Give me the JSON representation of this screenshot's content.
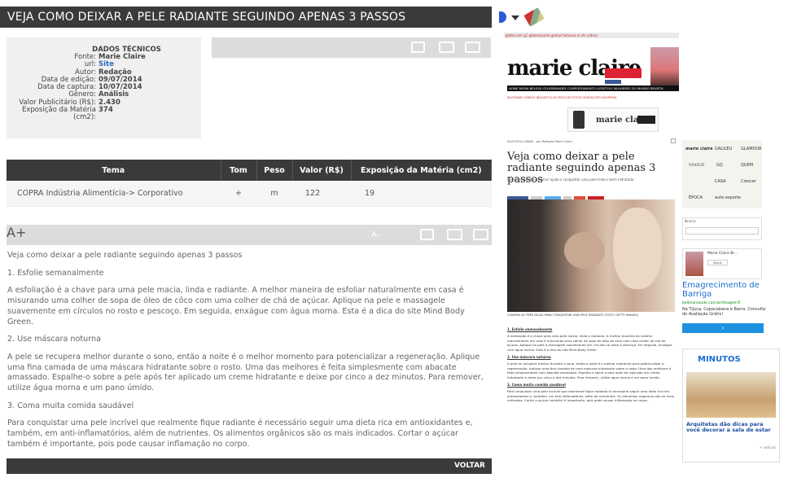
{
  "header": {
    "title": "VEJA COMO DEIXAR A PELE RADIANTE SEGUINDO APENAS 3 PASSOS"
  },
  "tech": {
    "heading": "DADOS TÉCNICOS",
    "rows": [
      {
        "k": "Fonte:",
        "v": "Marie Claire"
      },
      {
        "k": "url:",
        "v": "Site"
      },
      {
        "k": "Autor:",
        "v": "Redação"
      },
      {
        "k": "Data de edição:",
        "v": "09/07/2014"
      },
      {
        "k": "Data de captura:",
        "v": "10/07/2014"
      },
      {
        "k": "Gênero:",
        "v": "Análisis"
      },
      {
        "k": "Valor Publicitário (R$):",
        "v": "2.430"
      },
      {
        "k": "Exposição da Matéria (cm2):",
        "v": "374"
      }
    ]
  },
  "table": {
    "headers": [
      "Tema",
      "Tom",
      "Peso",
      "Valor (R$)",
      "Exposição da Matéria (cm2)"
    ],
    "row": [
      "COPRA Indústria Alimentícia-> Corporativo",
      "+",
      "m",
      "122",
      "19"
    ]
  },
  "toolbar2": {
    "a_minus": "A-",
    "a_plus": "A+"
  },
  "article": {
    "paragraphs": [
      "Veja como deixar a pele radiante seguindo apenas 3 passos",
      "1. Esfolie semanalmente",
      "A esfoliação é a chave para uma pele macia, linda e radiante. A melhor maneira de esfoliar naturalmente em casa é misurando uma colher de sopa de óleo de côco com uma colher de chá de açúcar. Aplique na pele e massagele suavemente em círculos no rosto e pescoço. Em seguida, enxágue com água morna. Esta é a dica do site Mind Body Green.",
      "2. Use máscara noturna",
      "A pele se recupera melhor durante o sono, então a noite é o melhor momento para potencializar a regeneração. Aplique uma fina camada de uma máscara hidratante sobre o rosto. Uma das melhores é feita simplesmente com abacate amassado. Espalhe-o sobre a pele após ter aplicado um creme hidratante e deixe por cinco a dez minutos. Para remover, utilize água morna e um pano úmido.",
      "3. Coma muita comida saudável",
      "Para conquistar uma pele incrível que realmente fique radiante é necessário seguir uma dieta rica em antioxidantes e, também, em anti-inflamatórios, além de nutrientes. Os alimentos orgânicos são os mais indicados. Cortar o açúcar também é importante, pois pode causar inflamação no corpo."
    ]
  },
  "footer": {
    "voltar": "VOLTAR"
  },
  "clipping": {
    "topbar": "globo.com  g1  globoesporte  gshow  famosos & etc  vídeos",
    "logo": "marie claire",
    "nav": "HOME  MODA  BELEZA  CELEBRIDADES  COMPORTAMENTO  LIFESTYLE  MULHERES DO MUNDO  REVISTA",
    "subnav": "PILOTANDO  VÍDEOS  INQUIETOS  AO PROG DE FOTOS  HORÓSCOPO  SHOPPING",
    "app_brand": "marie claire",
    "credit": "09/07/2014 08h00 - por Redação Marie Claire",
    "title": "Veja como deixar a pele radiante seguindo apenas 3 passos",
    "subtitle": "Use ingredientes caseiros ajuda a conquistar uma pele linda e bem hidratada",
    "caption": "CONFIRA AS TRÊS DICAS PARA CONQUISTAR UMA PELE RADIANTE (FOTO: GETTY IMAGES)",
    "s1": "1. Esfolie semanalmente",
    "p1": "A esfoliação é a chave para uma pele macia, linda e radiante. A melhor maneira de esfoliar naturalmente em casa é misurando uma colher de sopa de óleo de côco com uma colher de chá de açúcar. Aplique na pele e massageie suavemente em círculos no rosto e pescoço. Em seguida, enxágue com água morna. Esta é a dica do site Mind Body Green.",
    "s2": "2. Use máscara noturna",
    "p2": "A pele se recupera melhor durante o sono, então a noite é o melhor momento para potencializar a regeneração. Aplique uma fina camada de uma máscara hidratante sobre o rosto. Uma das melhores é feita simplesmente com abacate amassado. Espalhe-o sobre a pele após ter aplicado um creme hidratante e deixe por cinco a dez minutos. Para remover, utilize água morna e um pano úmido.",
    "s3": "3. Coma muita comida saudável",
    "p3": "Para conquistar uma pele incrível que realmente fique radiante é necessário seguir uma dieta rica em antioxidantes e, também, em anti-inflamatórios, além de nutrientes. Os alimentos orgânicos são os mais indicados. Cortar o açúcar também é importante, pois pode causar inflamação no corpo."
  },
  "ads": {
    "brands": [
      "marie claire",
      "GALILEU",
      "GLAMOUR",
      "VOGUE",
      "GQ",
      "QUEM",
      "CASA",
      "Crescer",
      "ÉPOCA",
      "auto esporte"
    ],
    "busca": "Busca",
    "gplus_name": "Marie Claire Br...",
    "gplus_follow": "Seguir",
    "ad_head": "Emagrecimento de Barriga",
    "ad_link": "bellmarsaude.com.br/ImagemTr",
    "ad_desc": "Na Tijuca, Copacabana e Barra. Consulta de Avaliação Grátis!",
    "min_head": "MINUTOS",
    "min_title": "Arquitetas dão dicas para você decorar a sala de estar",
    "min_more": "+ notícias"
  }
}
